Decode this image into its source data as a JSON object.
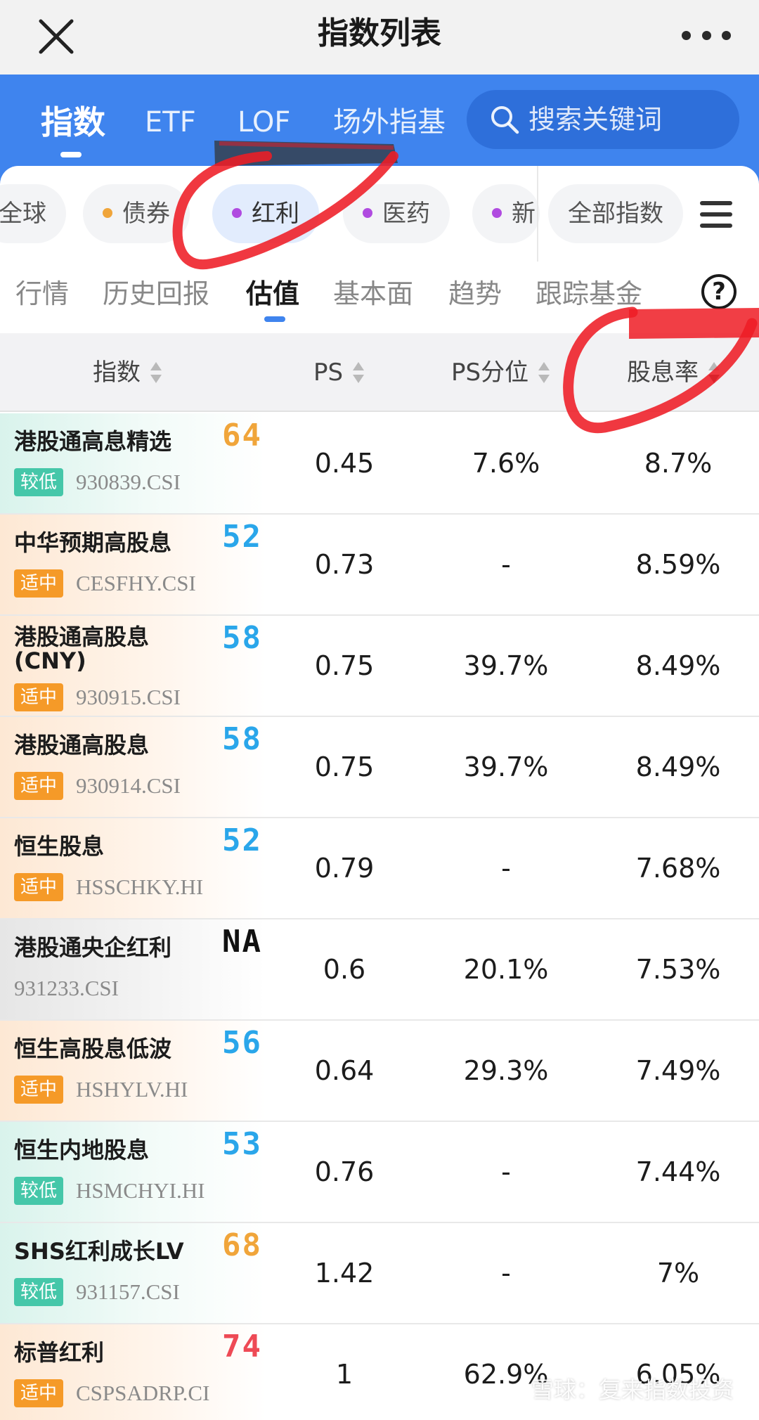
{
  "titlebar": {
    "title": "指数列表"
  },
  "main_tabs": [
    {
      "label": "指数",
      "active": true
    },
    {
      "label": "ETF",
      "active": false
    },
    {
      "label": "LOF",
      "active": false
    },
    {
      "label": "场外指基",
      "active": false
    }
  ],
  "search": {
    "placeholder": "搜索关键词"
  },
  "categories": [
    {
      "label": "全球",
      "dot_color": ""
    },
    {
      "label": "债券",
      "dot_color": "#f0a53a"
    },
    {
      "label": "红利",
      "dot_color": "#b04be0",
      "active": true
    },
    {
      "label": "医药",
      "dot_color": "#b04be0"
    },
    {
      "label": "新",
      "dot_color": "#b04be0"
    },
    {
      "label": "全部指数",
      "dot_color": ""
    }
  ],
  "sub_tabs": [
    {
      "label": "行情",
      "active": false
    },
    {
      "label": "历史回报",
      "active": false
    },
    {
      "label": "估值",
      "active": true
    },
    {
      "label": "基本面",
      "active": false
    },
    {
      "label": "趋势",
      "active": false
    },
    {
      "label": "跟踪基金",
      "active": false
    }
  ],
  "help": "?",
  "table": {
    "headers": {
      "index": "指数",
      "ps": "PS",
      "ps_pct": "PS分位",
      "dividend": "股息率"
    },
    "rows": [
      {
        "name": "港股通高息精选",
        "name2": "",
        "badge": "较低",
        "level": "low",
        "code": "930839.CSI",
        "score": "64",
        "score_color": "#f0a53a",
        "ps": "0.45",
        "ps_pct": "7.6%",
        "dividend": "8.7%"
      },
      {
        "name": "中华预期高股息",
        "name2": "",
        "badge": "适中",
        "level": "mid",
        "code": "CESFHY.CSI",
        "score": "52",
        "score_color": "#2aa6ea",
        "ps": "0.73",
        "ps_pct": "-",
        "dividend": "8.59%"
      },
      {
        "name": "港股通高股息",
        "name2": "(CNY)",
        "badge": "适中",
        "level": "mid",
        "code": "930915.CSI",
        "score": "58",
        "score_color": "#2aa6ea",
        "ps": "0.75",
        "ps_pct": "39.7%",
        "dividend": "8.49%"
      },
      {
        "name": "港股通高股息",
        "name2": "",
        "badge": "适中",
        "level": "mid",
        "code": "930914.CSI",
        "score": "58",
        "score_color": "#2aa6ea",
        "ps": "0.75",
        "ps_pct": "39.7%",
        "dividend": "8.49%"
      },
      {
        "name": "恒生股息",
        "name2": "",
        "badge": "适中",
        "level": "mid",
        "code": "HSSCHKY.HI",
        "score": "52",
        "score_color": "#2aa6ea",
        "ps": "0.79",
        "ps_pct": "-",
        "dividend": "7.68%"
      },
      {
        "name": "港股通央企红利",
        "name2": "",
        "badge": "",
        "level": "na",
        "code": "931233.CSI",
        "score": "NA",
        "score_color": "#111111",
        "ps": "0.6",
        "ps_pct": "20.1%",
        "dividend": "7.53%"
      },
      {
        "name": "恒生高股息低波",
        "name2": "",
        "badge": "适中",
        "level": "mid",
        "code": "HSHYLV.HI",
        "score": "56",
        "score_color": "#2aa6ea",
        "ps": "0.64",
        "ps_pct": "29.3%",
        "dividend": "7.49%"
      },
      {
        "name": "恒生内地股息",
        "name2": "",
        "badge": "较低",
        "level": "low",
        "code": "HSMCHYI.HI",
        "score": "53",
        "score_color": "#2aa6ea",
        "ps": "0.76",
        "ps_pct": "-",
        "dividend": "7.44%"
      },
      {
        "name": "SHS红利成长LV",
        "name2": "",
        "badge": "较低",
        "level": "low",
        "code": "931157.CSI",
        "score": "68",
        "score_color": "#f0a53a",
        "ps": "1.42",
        "ps_pct": "-",
        "dividend": "7%"
      },
      {
        "name": "标普红利",
        "name2": "",
        "badge": "适中",
        "level": "mid",
        "code": "CSPSADRP.CI",
        "score": "74",
        "score_color": "#ee4a55",
        "ps": "1",
        "ps_pct": "62.9%",
        "dividend": "6.05%"
      }
    ]
  },
  "watermark": "雪球：复来指数投资",
  "colors": {
    "brand_blue": "#3f84ee",
    "low_badge": "#45c7a9",
    "mid_badge": "#f59a28",
    "annotation_red": "#ee1c25"
  }
}
